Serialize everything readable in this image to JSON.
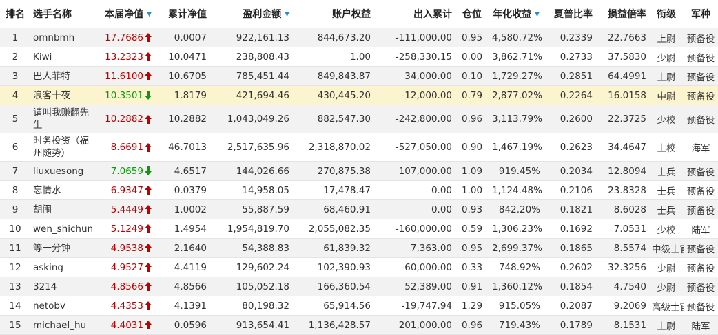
{
  "headers": {
    "rank": "排名",
    "name": "选手名称",
    "nav": "本届净值",
    "cum": "累计净值",
    "profit": "盈利金额",
    "equity": "账户权益",
    "flow": "出入累计",
    "pos": "仓位",
    "annual": "年化收益",
    "sharpe": "夏普比率",
    "plr": "损益倍率",
    "grade": "衔级",
    "army": "军种"
  },
  "sort_icon": "sort-down-triangle",
  "colors": {
    "up": "#c00000",
    "down": "#0a9a0a",
    "highlight": "#fbf4cf",
    "sort": "#1a8fd6"
  },
  "rows": [
    {
      "rank": "1",
      "name": "omnbmh",
      "nav": "17.7686",
      "trend": "up",
      "cum": "0.0007",
      "profit": "922,161.13",
      "equity": "844,673.20",
      "flow": "-111,000.00",
      "pos": "0.95",
      "annual": "4,580.72%",
      "sharpe": "0.2339",
      "plr": "22.7663",
      "grade": "上尉",
      "army": "预备役"
    },
    {
      "rank": "2",
      "name": "Kiwi",
      "nav": "13.2323",
      "trend": "up",
      "cum": "10.0471",
      "profit": "238,808.43",
      "equity": "1.00",
      "flow": "-258,330.15",
      "pos": "0.00",
      "annual": "3,862.71%",
      "sharpe": "0.2733",
      "plr": "37.5830",
      "grade": "少尉",
      "army": "预备役"
    },
    {
      "rank": "3",
      "name": "巴人菲特",
      "nav": "11.6100",
      "trend": "up",
      "cum": "10.6705",
      "profit": "785,451.44",
      "equity": "849,843.87",
      "flow": "34,000.00",
      "pos": "0.10",
      "annual": "1,729.27%",
      "sharpe": "0.2851",
      "plr": "64.4991",
      "grade": "上尉",
      "army": "预备役"
    },
    {
      "rank": "4",
      "name": "浪客十夜",
      "nav": "10.3501",
      "trend": "down",
      "cum": "1.8179",
      "profit": "421,694.46",
      "equity": "430,445.20",
      "flow": "-12,000.00",
      "pos": "0.79",
      "annual": "2,877.02%",
      "sharpe": "0.2264",
      "plr": "16.0158",
      "grade": "中尉",
      "army": "预备役"
    },
    {
      "rank": "5",
      "name": "请叫我赚翻先生",
      "nav": "10.2882",
      "trend": "up",
      "cum": "10.2882",
      "profit": "1,043,049.26",
      "equity": "882,547.30",
      "flow": "-242,800.00",
      "pos": "0.96",
      "annual": "3,113.79%",
      "sharpe": "0.2600",
      "plr": "22.3725",
      "grade": "少校",
      "army": "预备役"
    },
    {
      "rank": "6",
      "name": "时务投资（福州随势）",
      "nav": "8.6691",
      "trend": "up",
      "cum": "46.7013",
      "profit": "2,517,635.96",
      "equity": "2,318,870.02",
      "flow": "-527,050.00",
      "pos": "0.90",
      "annual": "1,467.19%",
      "sharpe": "0.2623",
      "plr": "34.4647",
      "grade": "上校",
      "army": "海军"
    },
    {
      "rank": "7",
      "name": "liuxuesong",
      "nav": "7.0659",
      "trend": "down",
      "cum": "4.6517",
      "profit": "144,026.66",
      "equity": "270,875.38",
      "flow": "107,000.00",
      "pos": "1.09",
      "annual": "919.45%",
      "sharpe": "0.2034",
      "plr": "12.8094",
      "grade": "士兵",
      "army": "预备役"
    },
    {
      "rank": "8",
      "name": "忘情水",
      "nav": "6.9347",
      "trend": "up",
      "cum": "0.0379",
      "profit": "14,958.05",
      "equity": "17,478.47",
      "flow": "0.00",
      "pos": "1.00",
      "annual": "1,124.48%",
      "sharpe": "0.2106",
      "plr": "23.8328",
      "grade": "士兵",
      "army": "预备役"
    },
    {
      "rank": "9",
      "name": "胡闹",
      "nav": "5.4449",
      "trend": "up",
      "cum": "1.0002",
      "profit": "55,887.59",
      "equity": "68,460.91",
      "flow": "0.00",
      "pos": "0.93",
      "annual": "842.20%",
      "sharpe": "0.1821",
      "plr": "8.6028",
      "grade": "士兵",
      "army": "预备役"
    },
    {
      "rank": "10",
      "name": "wen_shichun",
      "nav": "5.1249",
      "trend": "up",
      "cum": "1.4954",
      "profit": "1,954,819.70",
      "equity": "2,055,082.35",
      "flow": "-160,000.00",
      "pos": "0.59",
      "annual": "1,306.23%",
      "sharpe": "0.1692",
      "plr": "7.0531",
      "grade": "少校",
      "army": "陆军"
    },
    {
      "rank": "11",
      "name": "等一分钟",
      "nav": "4.9538",
      "trend": "up",
      "cum": "2.1640",
      "profit": "54,388.83",
      "equity": "61,839.32",
      "flow": "7,363.00",
      "pos": "0.95",
      "annual": "2,699.37%",
      "sharpe": "0.1865",
      "plr": "8.5574",
      "grade": "中级士官",
      "army": "预备役"
    },
    {
      "rank": "12",
      "name": "asking",
      "nav": "4.9527",
      "trend": "up",
      "cum": "4.4119",
      "profit": "129,602.24",
      "equity": "102,390.93",
      "flow": "-60,000.00",
      "pos": "0.33",
      "annual": "748.92%",
      "sharpe": "0.2602",
      "plr": "32.3256",
      "grade": "少尉",
      "army": "预备役"
    },
    {
      "rank": "13",
      "name": "3214",
      "nav": "4.8566",
      "trend": "up",
      "cum": "4.8566",
      "profit": "105,052.18",
      "equity": "166,360.54",
      "flow": "52,389.00",
      "pos": "0.91",
      "annual": "1,360.12%",
      "sharpe": "0.1854",
      "plr": "4.7540",
      "grade": "少尉",
      "army": "预备役"
    },
    {
      "rank": "14",
      "name": "netobv",
      "nav": "4.4353",
      "trend": "up",
      "cum": "4.1391",
      "profit": "80,198.32",
      "equity": "65,914.56",
      "flow": "-19,747.94",
      "pos": "1.29",
      "annual": "915.05%",
      "sharpe": "0.2087",
      "plr": "9.2069",
      "grade": "高级士官",
      "army": "预备役"
    },
    {
      "rank": "15",
      "name": "michael_hu",
      "nav": "4.4031",
      "trend": "up",
      "cum": "0.0596",
      "profit": "913,654.41",
      "equity": "1,136,428.57",
      "flow": "201,000.00",
      "pos": "0.96",
      "annual": "719.43%",
      "sharpe": "0.1789",
      "plr": "8.1531",
      "grade": "上尉",
      "army": "陆军"
    }
  ]
}
